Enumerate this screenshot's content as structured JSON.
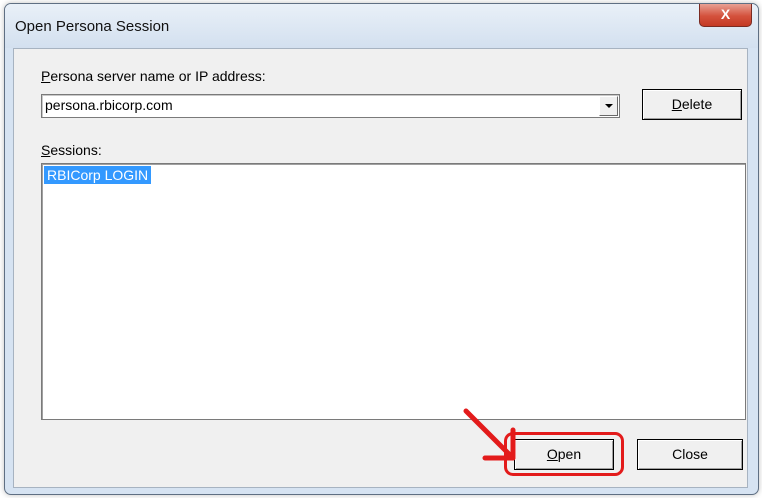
{
  "window": {
    "title": "Open Persona Session",
    "close_glyph": "X"
  },
  "server": {
    "label_first": "P",
    "label_rest": "ersona server name or IP address:",
    "value": "persona.rbicorp.com"
  },
  "buttons": {
    "delete_first": "D",
    "delete_rest": "elete",
    "open_first": "O",
    "open_rest": "pen",
    "close": "Close"
  },
  "sessions": {
    "label_first": "S",
    "label_rest": "essions:",
    "items": [
      {
        "label": "RBICorp LOGIN",
        "selected": true
      }
    ]
  },
  "annotation": {
    "color": "#e31b1b",
    "icon": "red-arrow-icon"
  }
}
